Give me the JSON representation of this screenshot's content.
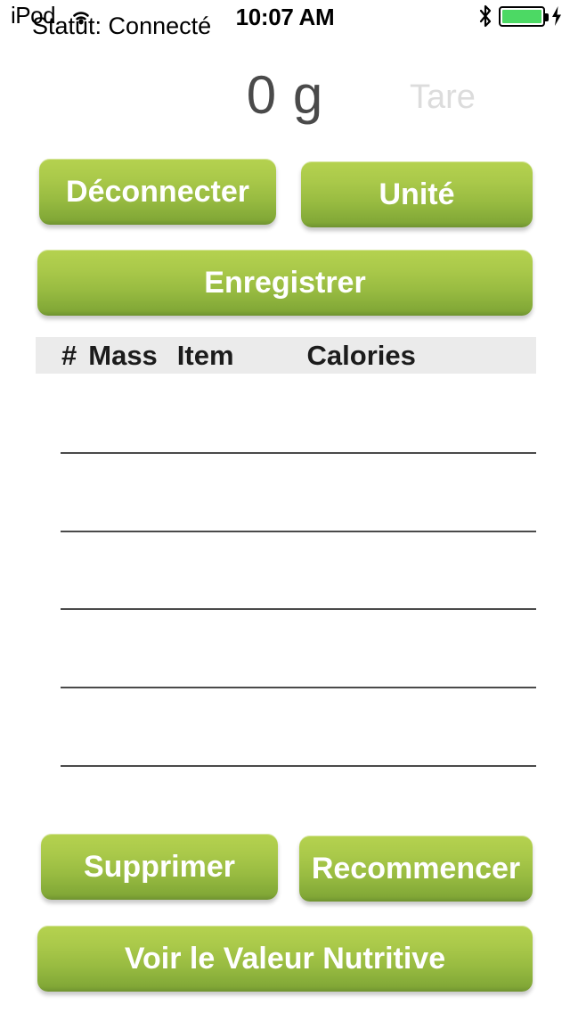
{
  "statusbar": {
    "carrier": "iPod",
    "wifi_icon": "wifi-icon",
    "time": "10:07 AM",
    "bluetooth_icon": "bluetooth-icon",
    "battery_icon": "battery-full-icon",
    "battery_level": 100,
    "battery_color": "#4cd964",
    "charging_icon": "lightning-bolt-icon"
  },
  "header": {
    "status_label": "Statut: Connecté",
    "weight_value": "0 g",
    "tare_label": "Tare",
    "tare_color": "#dcdcdc",
    "weight_color": "#4a4a4a"
  },
  "buttons": {
    "disconnect": "Déconnecter",
    "unit": "Unité",
    "save": "Enregistrer",
    "delete": "Supprimer",
    "restart": "Recommencer",
    "nutrition": "Voir le Valeur Nutritive",
    "accent_top": "#b5d24f",
    "accent_bottom": "#6f9330",
    "text_color": "#ffffff"
  },
  "table": {
    "columns": [
      "#",
      "Mass",
      "Item",
      "Calories"
    ],
    "header_bg": "#ebebeb",
    "separator_color": "#4a4a4a",
    "rows": [],
    "row_count": 5
  }
}
